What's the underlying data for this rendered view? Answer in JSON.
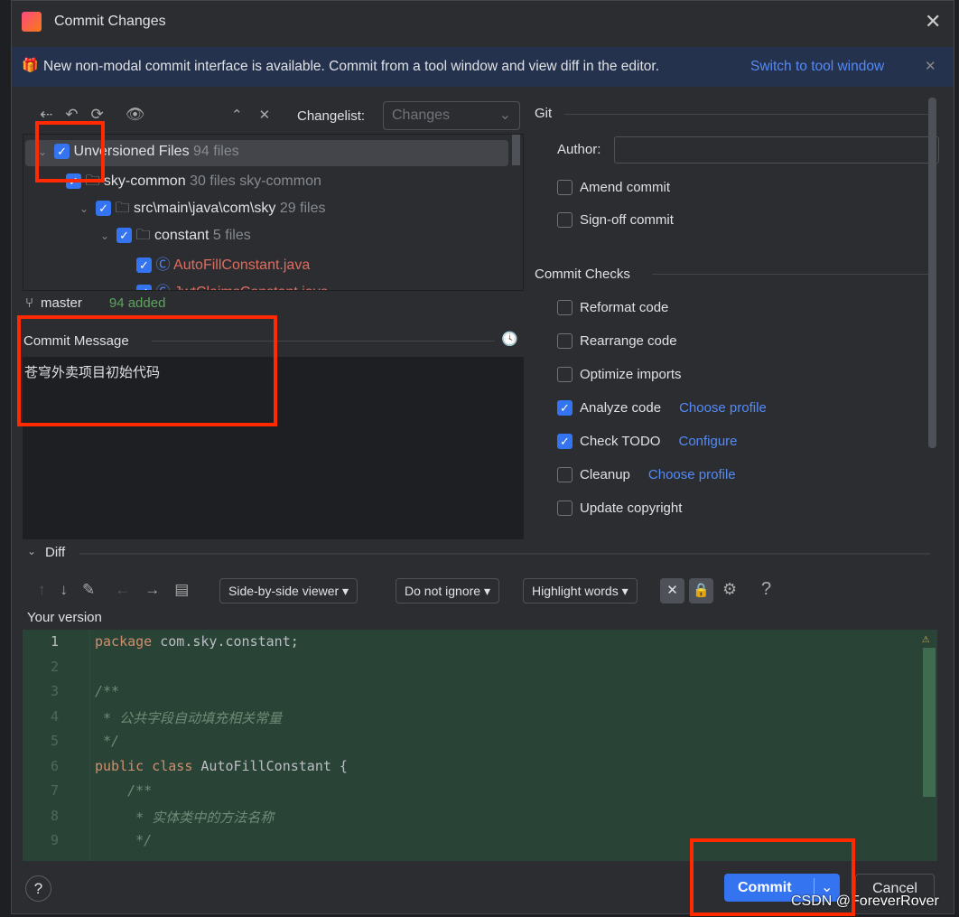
{
  "window": {
    "title": "Commit Changes"
  },
  "banner": {
    "text": "New non-modal commit interface is available. Commit from a tool window and view diff in the editor.",
    "link": "Switch to tool window"
  },
  "toolbar": {
    "changelist_label": "Changelist:",
    "changelist_value": "Changes"
  },
  "tree": [
    {
      "label": "Unversioned Files",
      "meta": "94 files",
      "level": 0
    },
    {
      "label": "sky-common",
      "meta": "30 files  sky-common",
      "level": 1
    },
    {
      "label": "src\\main\\java\\com\\sky",
      "meta": "29 files",
      "level": 2
    },
    {
      "label": "constant",
      "meta": "5 files",
      "level": 3
    },
    {
      "label": "AutoFillConstant.java",
      "meta": "",
      "level": 4
    },
    {
      "label": "JwtClaimsConstant.java",
      "meta": "",
      "level": 4
    }
  ],
  "status": {
    "branch": "master",
    "added": "94 added"
  },
  "commit_message": {
    "label": "Commit Message",
    "value": "苍穹外卖项目初始代码"
  },
  "git": {
    "title": "Git",
    "author_label": "Author:",
    "author_value": "",
    "options": [
      {
        "label": "Amend commit",
        "checked": false
      },
      {
        "label": "Sign-off commit",
        "checked": false
      }
    ]
  },
  "checks": {
    "title": "Commit Checks",
    "items": [
      {
        "label": "Reformat code",
        "checked": false,
        "link": ""
      },
      {
        "label": "Rearrange code",
        "checked": false,
        "link": ""
      },
      {
        "label": "Optimize imports",
        "checked": false,
        "link": ""
      },
      {
        "label": "Analyze code",
        "checked": true,
        "link": "Choose profile"
      },
      {
        "label": "Check TODO",
        "checked": true,
        "link": "Configure"
      },
      {
        "label": "Cleanup",
        "checked": false,
        "link": "Choose profile"
      },
      {
        "label": "Update copyright",
        "checked": false,
        "link": ""
      }
    ]
  },
  "diff": {
    "title": "Diff",
    "viewer": "Side-by-side viewer",
    "ignore": "Do not ignore",
    "highlight": "Highlight words",
    "version_label": "Your version",
    "lines": [
      {
        "n": "1",
        "html": "<span class='kw'>package</span> com.sky.constant;"
      },
      {
        "n": "2",
        "html": ""
      },
      {
        "n": "3",
        "html": "<span class='cm'>/**</span>"
      },
      {
        "n": "4",
        "html": "<span class='cm'> * 公共字段自动填充相关常量</span>"
      },
      {
        "n": "5",
        "html": "<span class='cm'> */</span>"
      },
      {
        "n": "6",
        "html": "<span class='kw'>public class</span> AutoFillConstant {"
      },
      {
        "n": "7",
        "html": "<span class='cm'>    /**</span>"
      },
      {
        "n": "8",
        "html": "<span class='cm'>     * 实体类中的方法名称</span>"
      },
      {
        "n": "9",
        "html": "<span class='cm'>     */</span>"
      }
    ]
  },
  "footer": {
    "help": "?",
    "commit": "Commit",
    "cancel": "Cancel"
  },
  "watermark": "CSDN @ForeverRover"
}
